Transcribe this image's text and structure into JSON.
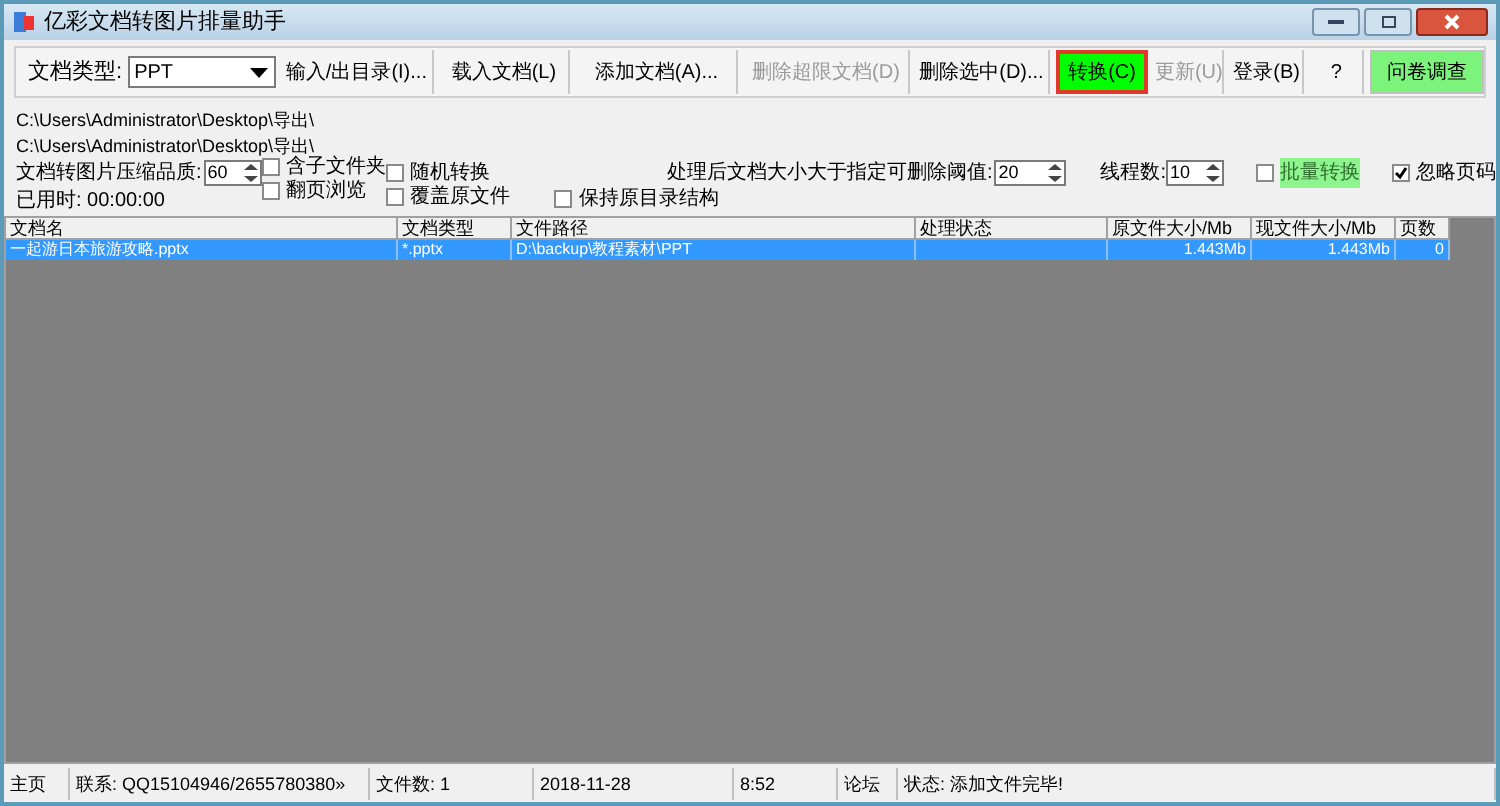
{
  "window": {
    "title": "亿彩文档转图片排量助手"
  },
  "toolbar": {
    "doc_type_label": "文档类型:",
    "doc_type_value": "PPT",
    "buttons": [
      {
        "label": "输入/出目录(I)...",
        "disabled": false,
        "kind": "normal"
      },
      {
        "label": "载入文档(L)",
        "disabled": false,
        "kind": "normal"
      },
      {
        "label": "添加文档(A)...",
        "disabled": false,
        "kind": "normal"
      },
      {
        "label": "删除超限文档(D)",
        "disabled": true,
        "kind": "normal"
      },
      {
        "label": "删除选中(D)...",
        "disabled": false,
        "kind": "normal"
      },
      {
        "label": "转换(C)",
        "disabled": false,
        "kind": "primary"
      },
      {
        "label": "更新(U)",
        "disabled": true,
        "kind": "normal"
      },
      {
        "label": "登录(B)",
        "disabled": false,
        "kind": "normal"
      },
      {
        "label": "?",
        "disabled": false,
        "kind": "normal"
      },
      {
        "label": "问卷调查",
        "disabled": false,
        "kind": "survey"
      }
    ]
  },
  "paths": [
    "C:\\Users\\Administrator\\Desktop\\导出\\",
    "C:\\Users\\Administrator\\Desktop\\导出\\"
  ],
  "options": {
    "quality_label": "文档转图片压缩品质:",
    "quality": "60",
    "elapsed": "已用时: 00:00:00",
    "checkboxes": [
      {
        "label": "含子文件夹",
        "checked": false,
        "disabled": false
      },
      {
        "label": "翻页浏览",
        "checked": false,
        "disabled": false
      },
      {
        "label": "随机转换",
        "checked": false,
        "disabled": false
      },
      {
        "label": "覆盖原文件",
        "checked": false,
        "disabled": false
      },
      {
        "label": "保持原目录结构",
        "checked": false,
        "disabled": false
      }
    ],
    "threshold_label": "处理后文档大小大于指定可删除阈值:",
    "threshold": "20",
    "threads_label": "线程数:",
    "threads": "10",
    "batch": {
      "label": "批量转换",
      "checked": false,
      "disabled": true
    },
    "ignore": {
      "label": "忽略页码",
      "checked": true,
      "disabled": false
    }
  },
  "table": {
    "columns": [
      "文档名",
      "文档类型",
      "文件路径",
      "处理状态",
      "原文件大小/Mb",
      "现文件大小/Mb",
      "页数"
    ],
    "rows": [
      {
        "selected": true,
        "cells": [
          "一起游日本旅游攻略.pptx",
          "*.pptx",
          "D:\\backup\\教程素材\\PPT",
          "",
          "1.443Mb",
          "1.443Mb",
          "0"
        ]
      }
    ]
  },
  "status_bar": [
    "主页",
    "联系: QQ15104946/2655780380»",
    "文件数: 1",
    "2018-11-28",
    "8:52",
    "论坛",
    "状态: 添加文件完毕!"
  ]
}
